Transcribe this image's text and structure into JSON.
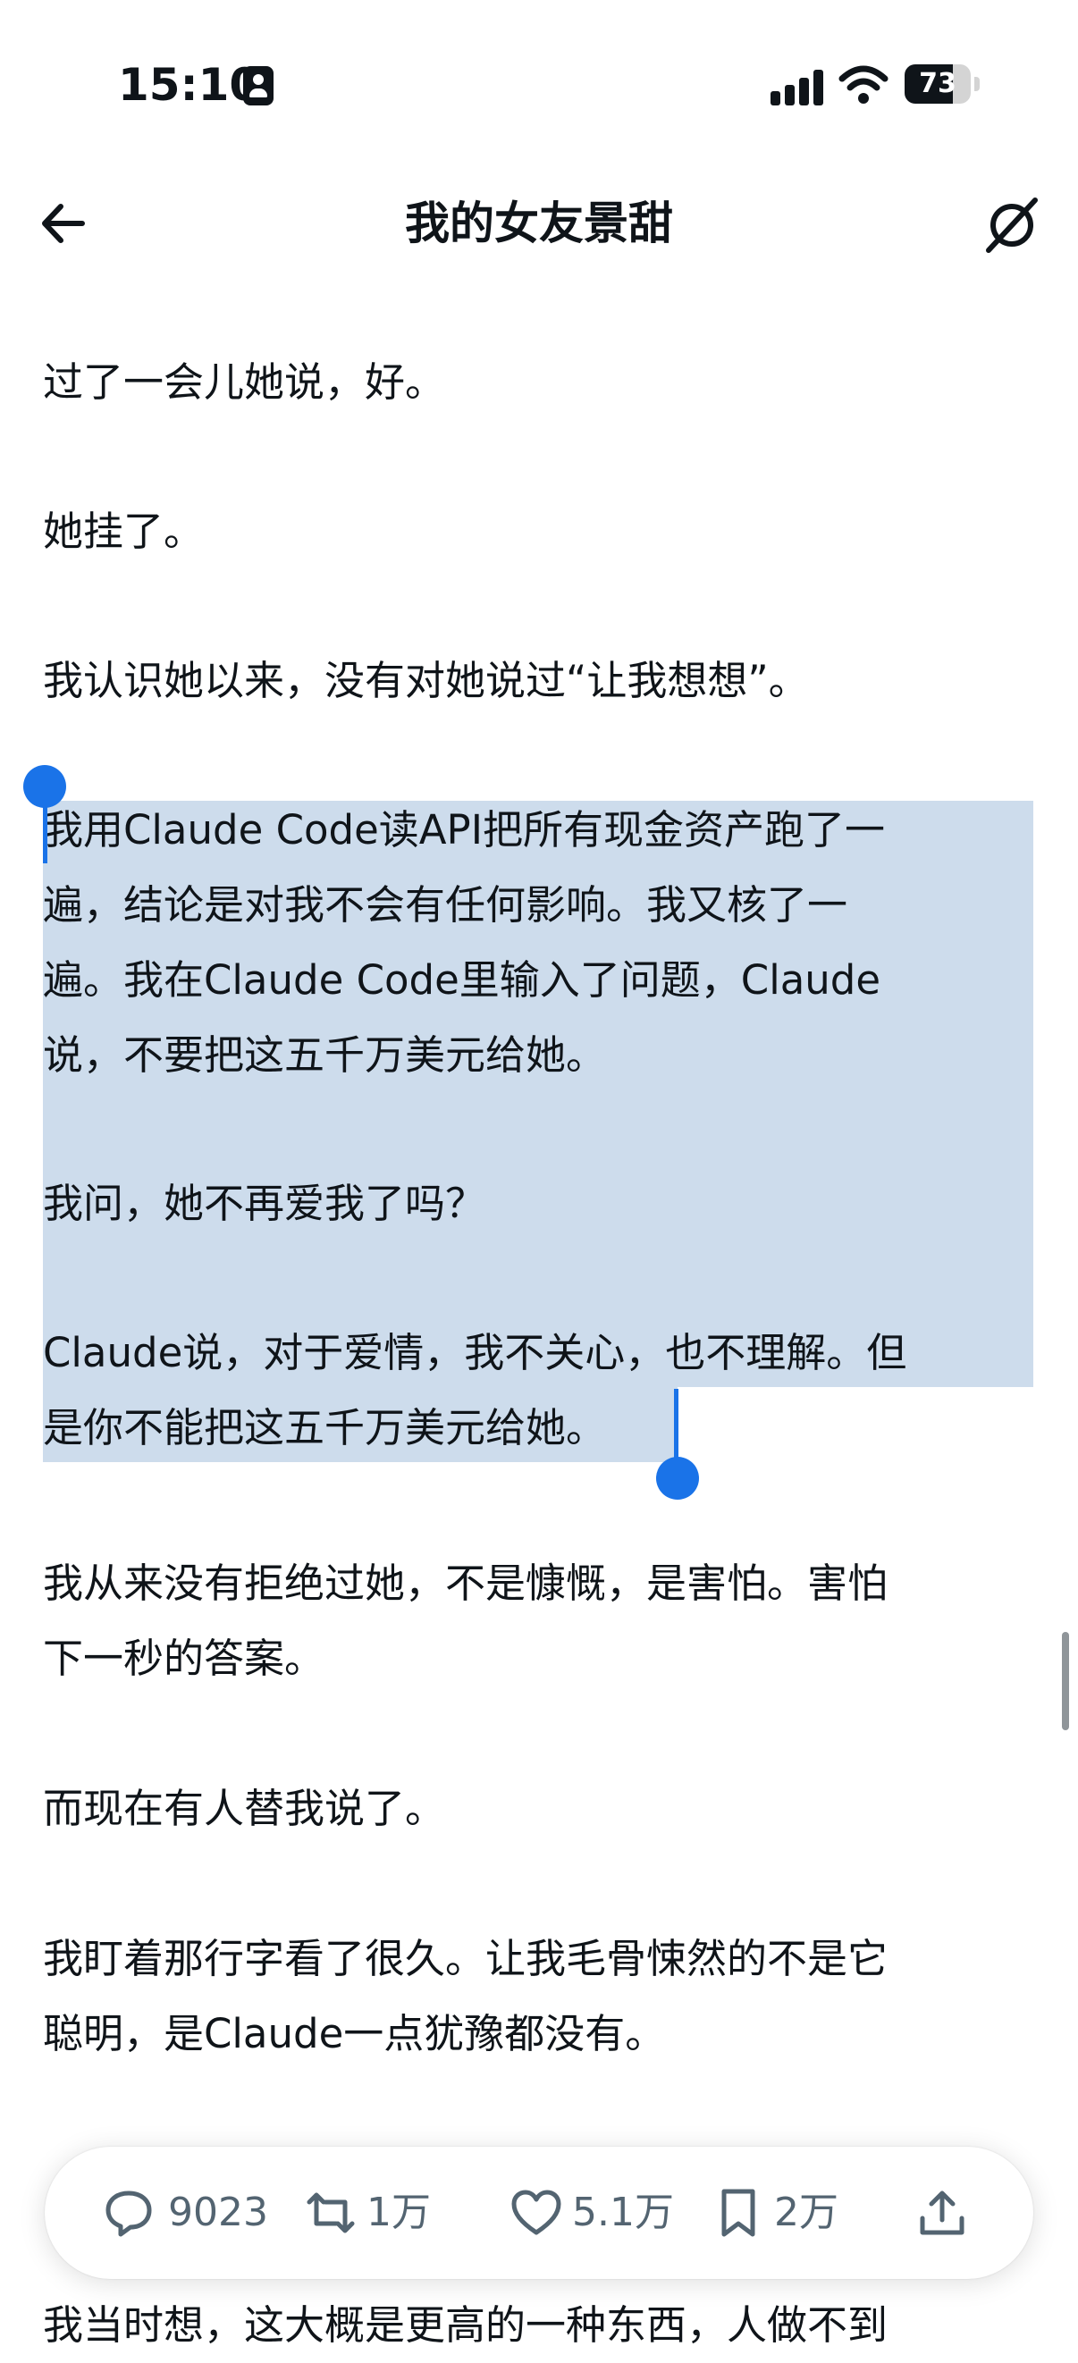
{
  "status_bar": {
    "time": "15:10",
    "battery_level": "73",
    "battery_fraction": 0.73
  },
  "nav": {
    "title": "我的女友景甜",
    "back_icon": "arrow-left-icon",
    "grok_icon": "grok-icon"
  },
  "article": {
    "paragraphs": [
      "过了一会儿她说，好。",
      "她挂了。",
      "我认识她以来，没有对她说过“让我想想”。",
      "我用Claude Code读API把所有现金资产跑了一\n遍，结论是对我不会有任何影响。我又核了一\n遍。我在Claude Code里输入了问题，Claude\n说，不要把这五千万美元给她。",
      "我问，她不再爱我了吗？",
      "Claude说，对于爱情，我不关心，也不理解。但\n是你不能把这五千万美元给她。",
      "我从来没有拒绝过她，不是慷慨，是害怕。害怕\n下一秒的答案。",
      "而现在有人替我说了。",
      "我盯着那行字看了很久。让我毛骨悚然的不是它\n聪明，是Claude一点犹豫都没有。",
      "我当时想，这大概是更高的一种东西，人做不到"
    ]
  },
  "actions": {
    "reply_count": "9023",
    "repost_count": "1万",
    "like_count": "5.1万",
    "bookmark_count": "2万",
    "icons": [
      "reply-icon",
      "repost-icon",
      "like-icon",
      "bookmark-icon",
      "share-icon"
    ]
  },
  "colors": {
    "selection": "#cddcec",
    "handle": "#1a73e8",
    "icon_gray": "#536471",
    "text": "#0f1419"
  }
}
